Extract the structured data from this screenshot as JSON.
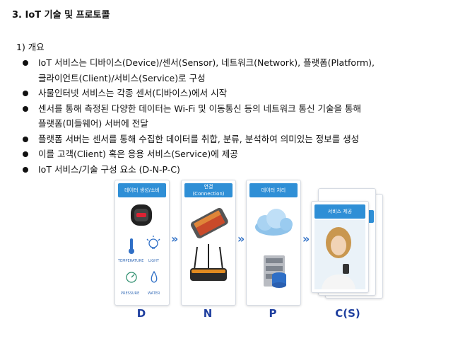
{
  "section_title": "3. IoT 기술 및 프로토콜",
  "subsection": "1) 개요",
  "bullets": [
    "IoT 서비스는 디바이스(Device)/센서(Sensor), 네트워크(Network), 플랫폼(Platform),",
    "사물인터넷 서비스는 각종 센서(디바이스)에서 시작",
    "센서를 통해 측정된 다양한 데이터는 Wi-Fi 및 이동통신 등의 네트워크 통신 기술을 통해",
    "플랫폼 서버는 센서를 통해 수집한 데이터를 취합, 분류, 분석하여 의미있는 정보를 생성",
    "이를 고객(Client) 혹은 응용 서비스(Service)에 제공",
    "IoT 서비스/기술 구성 요소 (D-N-P-C)"
  ],
  "bullet_continuations": [
    "클라이언트(Client)/서비스(Service)로 구성",
    "플랫폼(미들웨어) 서버에 전달"
  ],
  "diagram": {
    "panels": [
      {
        "title": "데이터 생성/소비",
        "subtitle": "",
        "letter": "D"
      },
      {
        "title": "연결",
        "subtitle": "(Connection)",
        "letter": "N"
      },
      {
        "title": "데이터 처리",
        "subtitle": "",
        "letter": "P"
      },
      {
        "title": "서비스 제공",
        "subtitle": "",
        "letter": "C(S)"
      }
    ],
    "sensor_labels": [
      "TEMPERATURE",
      "LIGHT",
      "PRESSURE",
      "WATER"
    ],
    "arrow_glyph": "»",
    "colors": {
      "header_blue": "#2f8fd6",
      "letter_blue": "#1f3f9f",
      "arrow_blue": "#2f6fc6"
    }
  }
}
